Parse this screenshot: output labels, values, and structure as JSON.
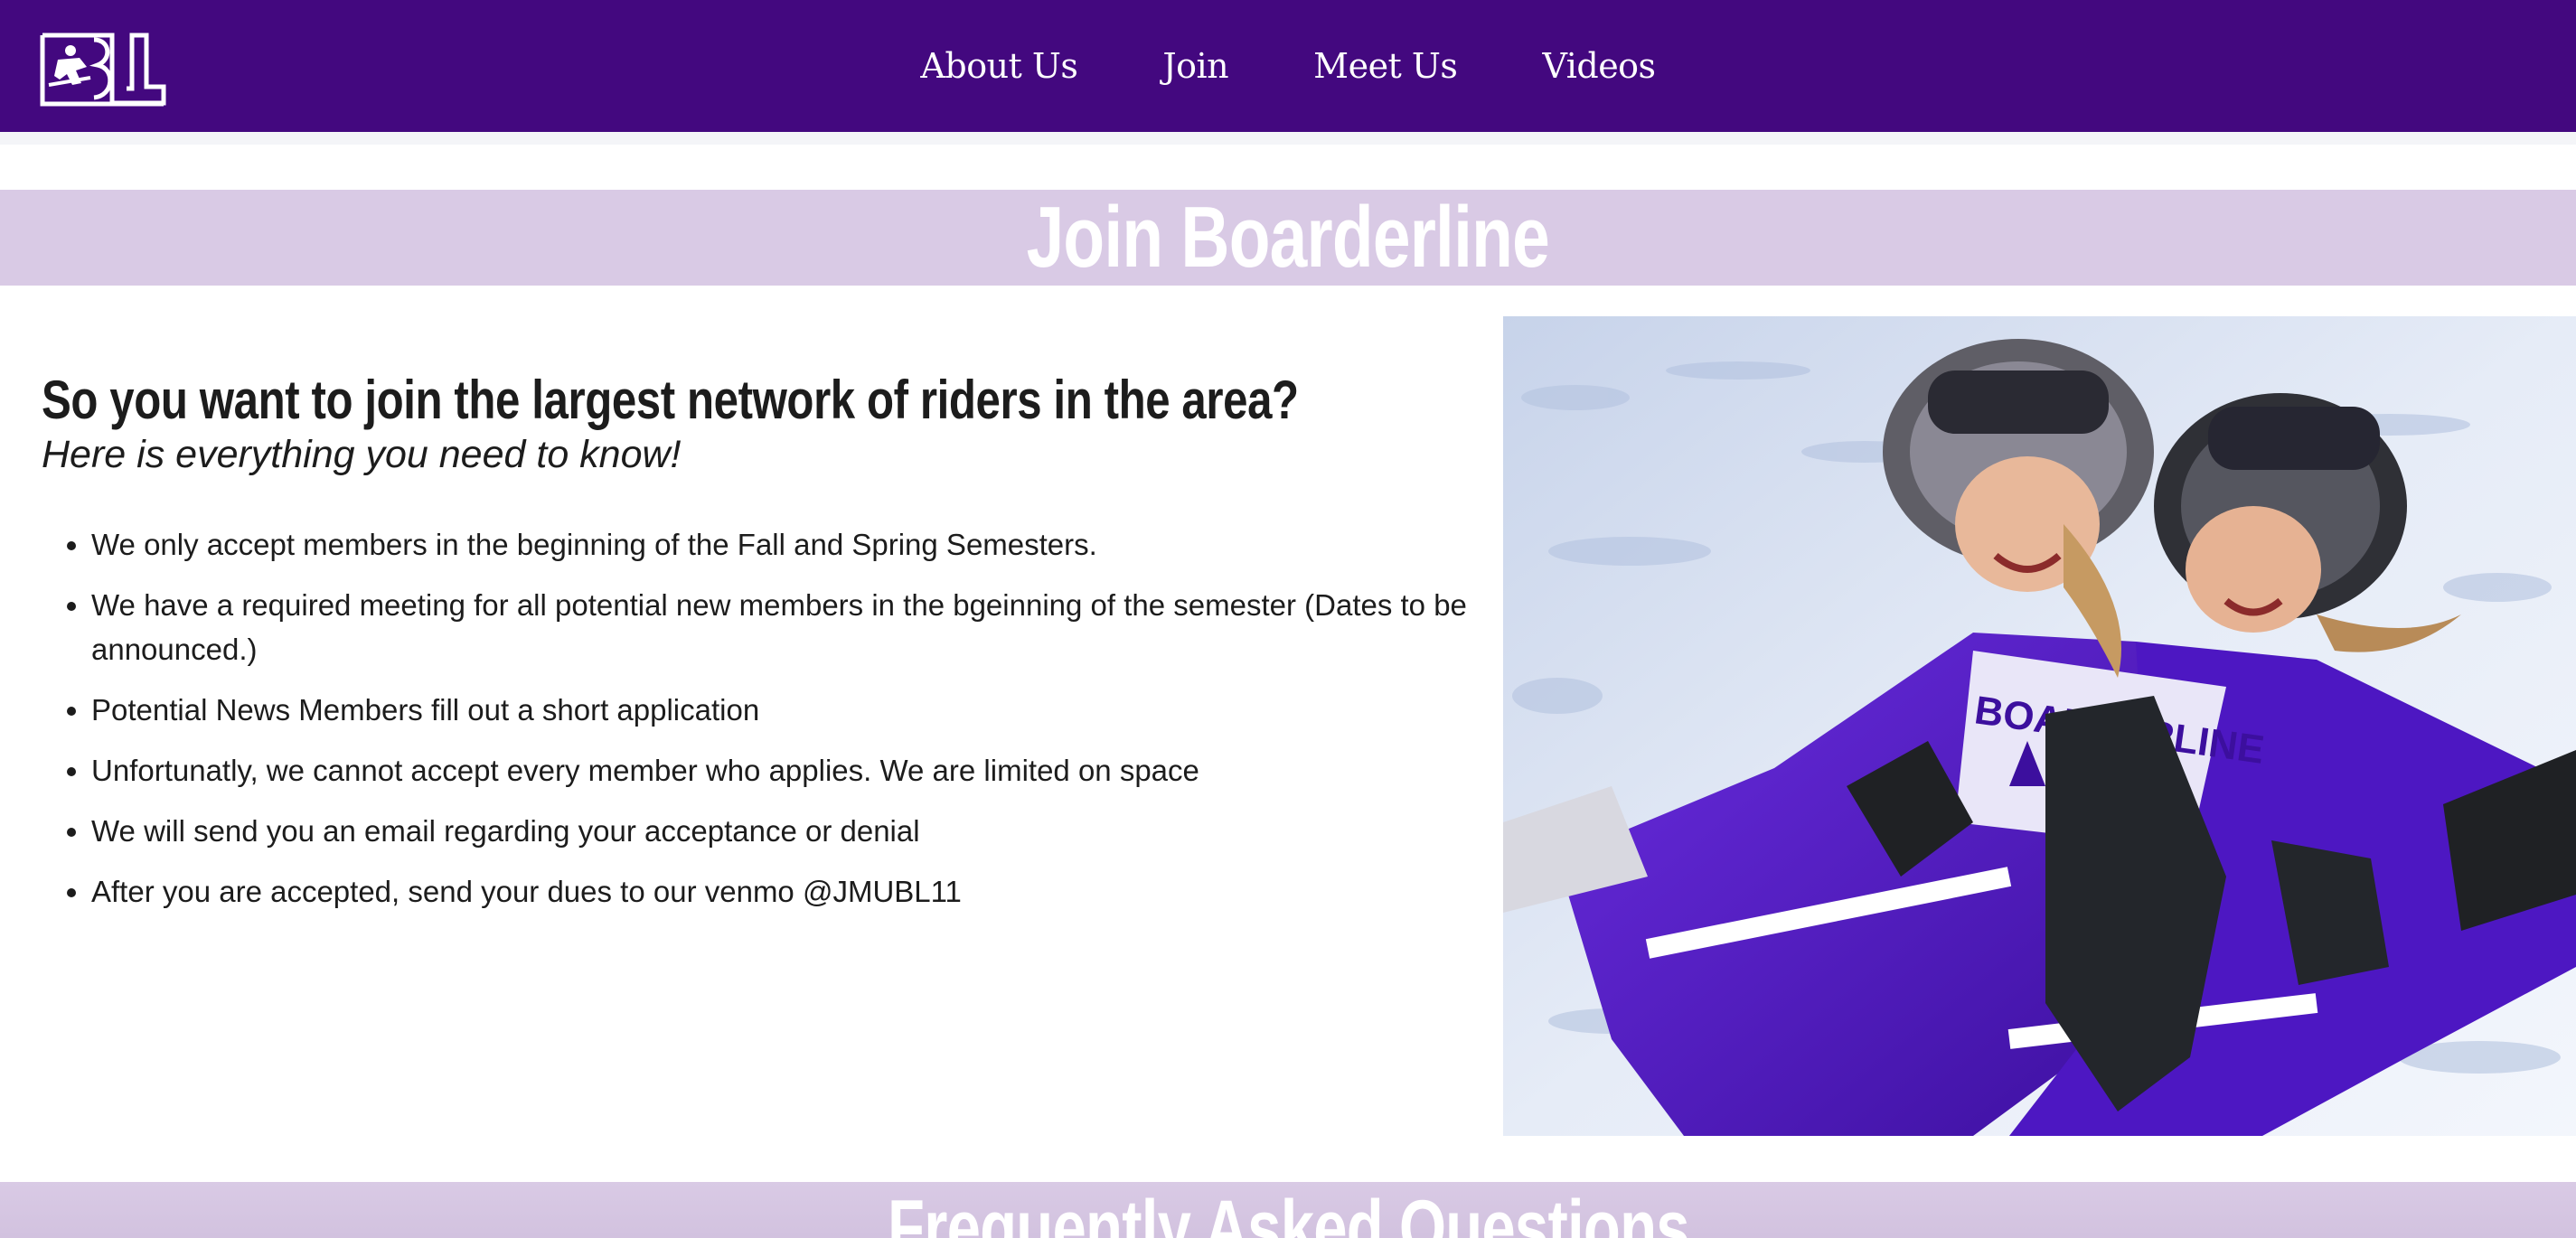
{
  "nav": {
    "logo_text": "BL",
    "links": [
      {
        "label": "About Us"
      },
      {
        "label": "Join"
      },
      {
        "label": "Meet Us"
      },
      {
        "label": "Videos"
      }
    ]
  },
  "join_banner": {
    "title": "Join Boarderline"
  },
  "intro": {
    "heading": "So you want to join the largest network of riders in the area?",
    "subheading": "Here is everything you need to know!"
  },
  "requirements": [
    "We only accept members in the beginning of the Fall and Spring Semesters.",
    "We have a required meeting for all potential new members in the bgeinning of the semester (Dates to be announced.)",
    "Potential News Members fill out a short application",
    "Unfortunatly, we cannot accept every member who applies. We are limited on space",
    "We will send you an email regarding your acceptance or denial",
    "After you are accepted, send your dues to our venmo @JMUBL11"
  ],
  "photo": {
    "jersey_text": "BOARDERLINE"
  },
  "faq_banner": {
    "title": "Frequently Asked Questions"
  },
  "colors": {
    "nav_bg": "#43087f",
    "banner_bg": "#d9cae5",
    "jersey_purple": "#5a1fc9"
  }
}
